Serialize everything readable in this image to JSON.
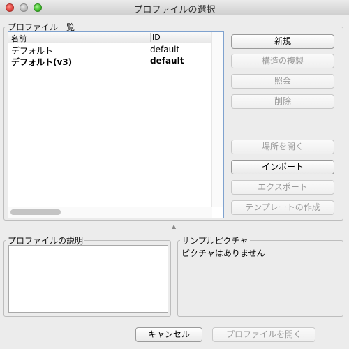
{
  "window": {
    "title": "プロファイルの選択"
  },
  "profiles": {
    "legend": "プロファイル一覧",
    "columns": {
      "name": "名前",
      "id": "ID"
    },
    "rows": [
      {
        "name": "デフォルト",
        "id": "default",
        "bold": false
      },
      {
        "name": "デフォルト(v3)",
        "id": "default",
        "bold": true
      }
    ]
  },
  "buttons": {
    "new": "新規",
    "duplicate": "構造の複製",
    "inspect": "照会",
    "delete": "削除",
    "open_location": "場所を開く",
    "import": "インポート",
    "export": "エクスポート",
    "create_template": "テンプレートの作成"
  },
  "description": {
    "legend": "プロファイルの説明",
    "value": ""
  },
  "sample": {
    "legend": "サンプルピクチャ",
    "text": "ピクチャはありません"
  },
  "footer": {
    "cancel": "キャンセル",
    "open_profile": "プロファイルを開く"
  }
}
